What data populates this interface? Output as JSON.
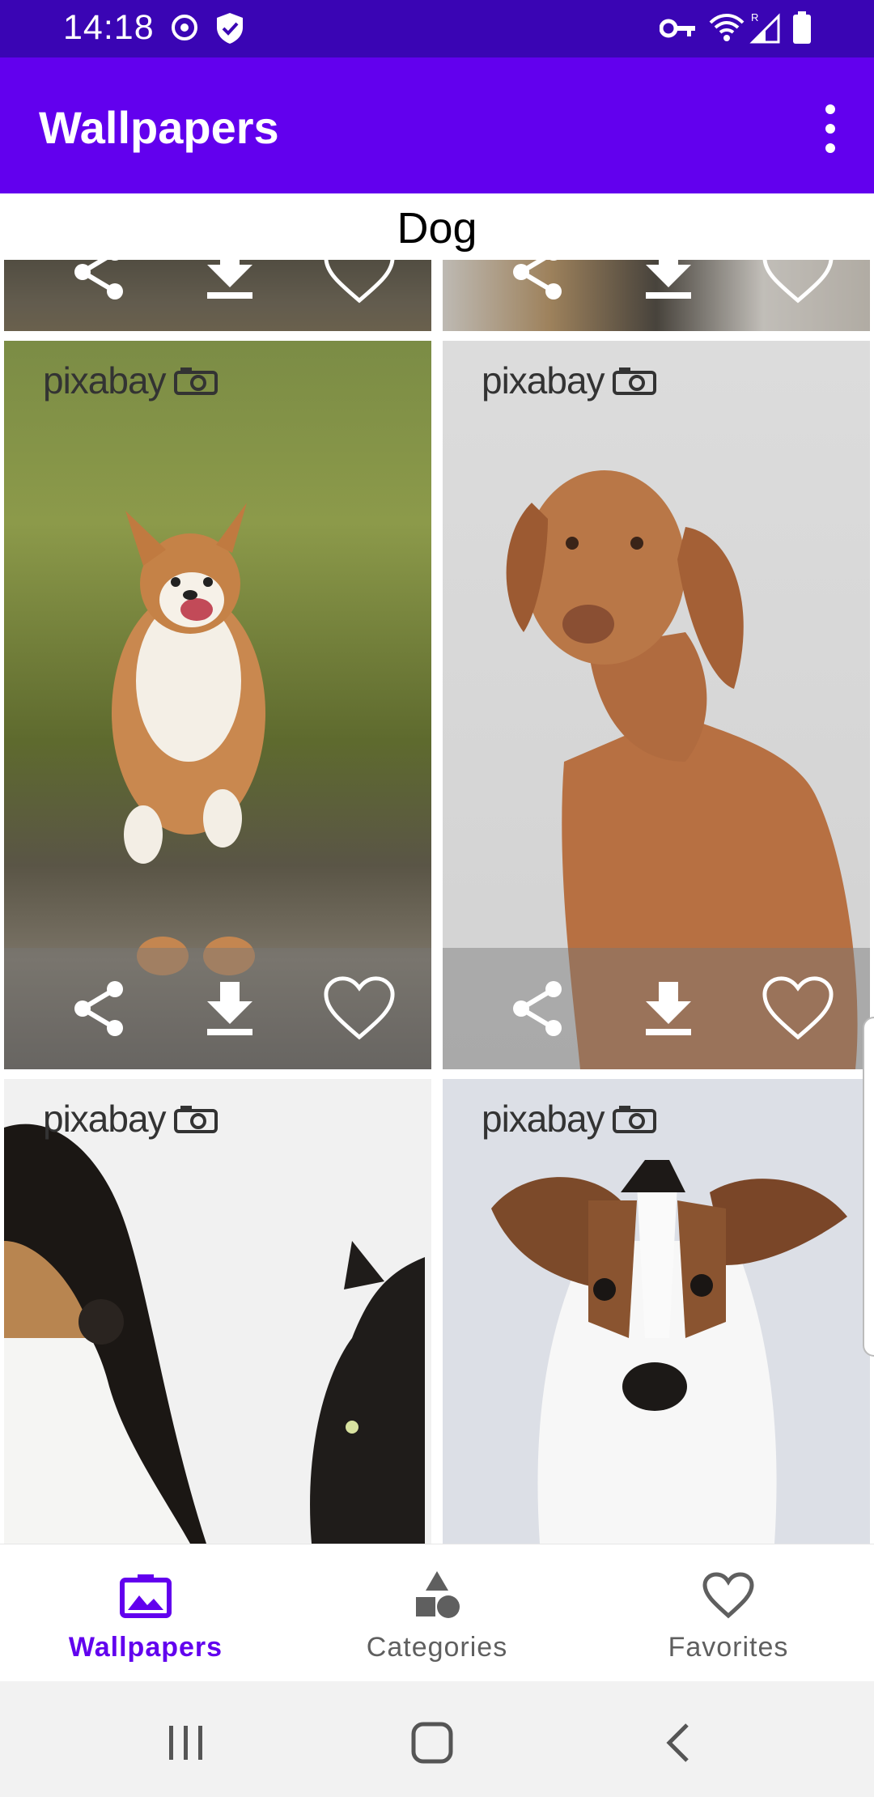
{
  "status_bar": {
    "time": "14:18",
    "icons": [
      "sync-icon",
      "shield-icon",
      "vpn-key-icon",
      "wifi-icon",
      "signal-icon",
      "battery-icon"
    ],
    "network_label": "R"
  },
  "app_bar": {
    "title": "Wallpapers",
    "overflow_icon": "more-vert-icon"
  },
  "category": {
    "title": "Dog"
  },
  "grid": {
    "watermark_text": "pixabay",
    "cards": [
      {
        "name": "partial-wallpaper-left",
        "description_icon": "dog-photo"
      },
      {
        "name": "partial-wallpaper-right",
        "description_icon": "dog-photo"
      },
      {
        "name": "corgi-wallpaper",
        "description_icon": "dog-photo"
      },
      {
        "name": "vizsla-wallpaper",
        "description_icon": "dog-photo"
      },
      {
        "name": "dog-and-cat-wallpaper",
        "description_icon": "dog-photo"
      },
      {
        "name": "jack-russell-wallpaper",
        "description_icon": "dog-photo"
      }
    ],
    "actions": [
      "share-icon",
      "download-icon",
      "favorite-icon"
    ]
  },
  "bottom_nav": {
    "items": [
      {
        "label": "Wallpapers",
        "icon": "image-icon",
        "active": true
      },
      {
        "label": "Categories",
        "icon": "category-icon",
        "active": false
      },
      {
        "label": "Favorites",
        "icon": "heart-icon",
        "active": false
      }
    ]
  },
  "system_nav": [
    "recents-icon",
    "home-icon",
    "back-icon"
  ],
  "colors": {
    "status_bar": "#3a05b4",
    "primary": "#6200ee",
    "nav_inactive": "#5f5f5f",
    "system_nav_bg": "#f2f2f2"
  }
}
